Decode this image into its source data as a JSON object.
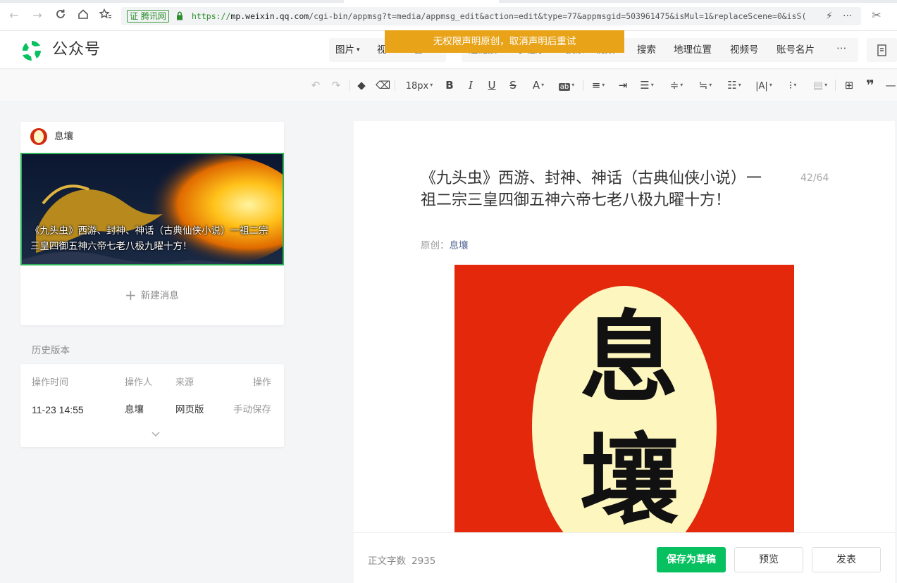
{
  "browser": {
    "cert_label": "证 腾讯网",
    "url_scheme": "https://",
    "url_host": "mp.weixin.qq.com",
    "url_path": "/cgi-bin/appmsg?t=media/appmsg_edit&action=edit&type=77&appmsgid=503961475&isMul=1&replaceScene=0&isS("
  },
  "header": {
    "logo_text": "公众号",
    "insert_left": [
      "图片",
      "视",
      "音"
    ],
    "insert_right_partial": [
      "超链接",
      "小程序",
      "投票",
      "视频"
    ],
    "insert_right": [
      "搜索",
      "地理位置",
      "视频号",
      "账号名片"
    ],
    "more_label": "···",
    "warning": "无权限声明原创，取消声明后重试"
  },
  "toolbar": {
    "font_size": "18px",
    "undo_icon": "undo-icon",
    "redo_icon": "redo-icon"
  },
  "left_panel": {
    "account_name": "息壤",
    "article_title": "《九头虫》西游、封神、神话（古典仙侠小说）一祖二宗三皇四御五神六帝七老八极九曜十方！",
    "new_message": "新建消息",
    "history_label": "历史版本",
    "history": {
      "columns": [
        "操作时间",
        "操作人",
        "来源",
        "操作"
      ],
      "rows": [
        [
          "11-23 14:55",
          "息壤",
          "网页版",
          "手动保存"
        ]
      ]
    }
  },
  "editor": {
    "title": "《九头虫》西游、封神、神话（古典仙侠小说）一祖二宗三皇四御五神六帝七老八极九曜十方！",
    "counter": "42/64",
    "byline_prefix": "原创：",
    "author": "息壤",
    "image_glyph_1": "息",
    "image_glyph_2": "壤"
  },
  "footer": {
    "word_count_label": "正文字数",
    "word_count": "2935",
    "save_draft": "保存为草稿",
    "preview": "预览",
    "publish": "发表"
  },
  "colors": {
    "brand_green": "#07c160",
    "warning": "#e8a318",
    "image_red": "#e3280c"
  }
}
